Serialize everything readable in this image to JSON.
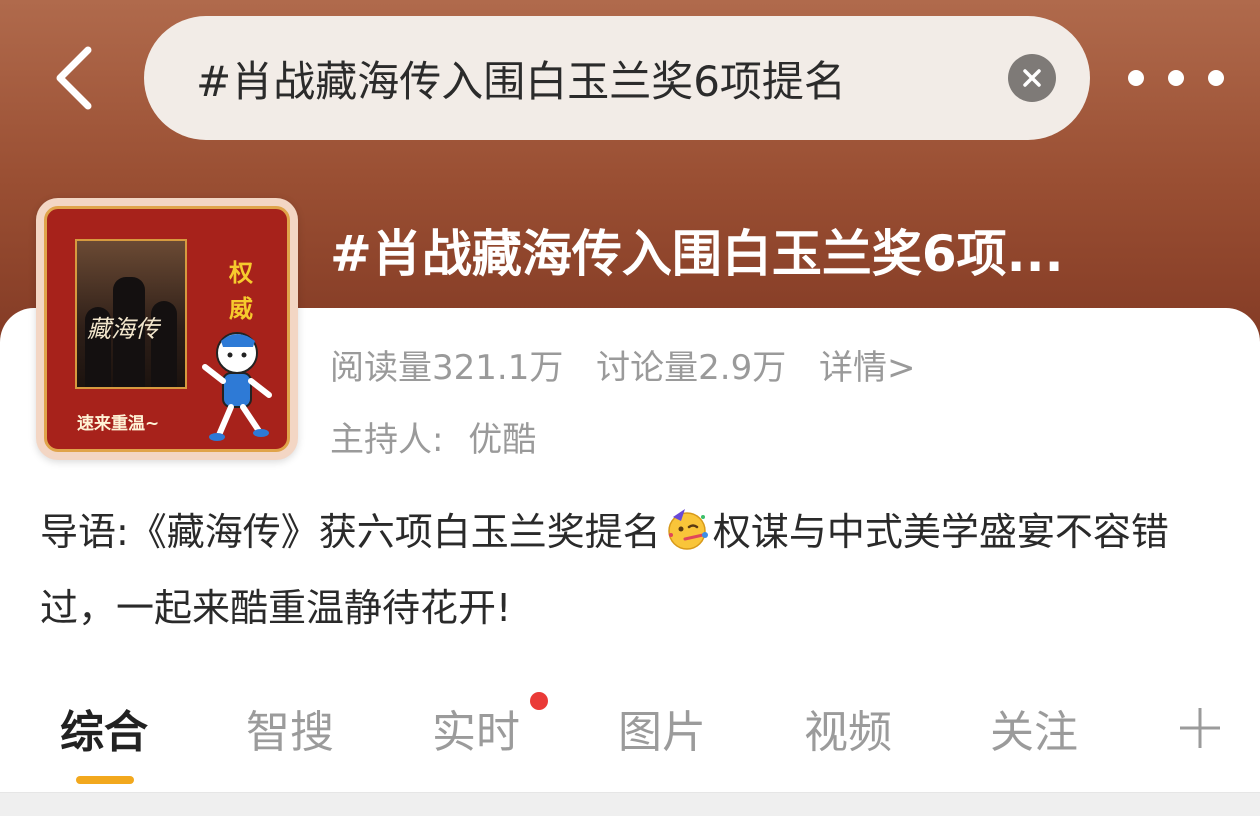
{
  "search": {
    "query": "#肖战藏海传入围白玉兰奖6项提名",
    "clear_icon": "close-circle-icon"
  },
  "topic": {
    "title": "#肖战藏海传入围白玉兰奖6项...",
    "reads": "阅读量321.1万",
    "discussions": "讨论量2.9万",
    "detail_link": "详情>",
    "host_label": "主持人:",
    "host_name": "优酷",
    "cover": {
      "side_text_1": "权",
      "side_text_2": "威",
      "drama_title": "藏海传",
      "bottom_text": "速来重温~"
    }
  },
  "intro": {
    "part1": "导语:《藏海传》获六项白玉兰奖提名",
    "emoji": "party-face-emoji",
    "part2": "权谋与中式美学盛宴不容错过，一起来酷重温静待花开!"
  },
  "tabs": [
    {
      "label": "综合"
    },
    {
      "label": "智搜"
    },
    {
      "label": "实时"
    },
    {
      "label": "图片"
    },
    {
      "label": "视频"
    },
    {
      "label": "关注"
    }
  ],
  "active_tab_index": 0,
  "colors": {
    "accent": "#f2a81d",
    "badge": "#ea3a37",
    "header": "#9a4f33"
  }
}
